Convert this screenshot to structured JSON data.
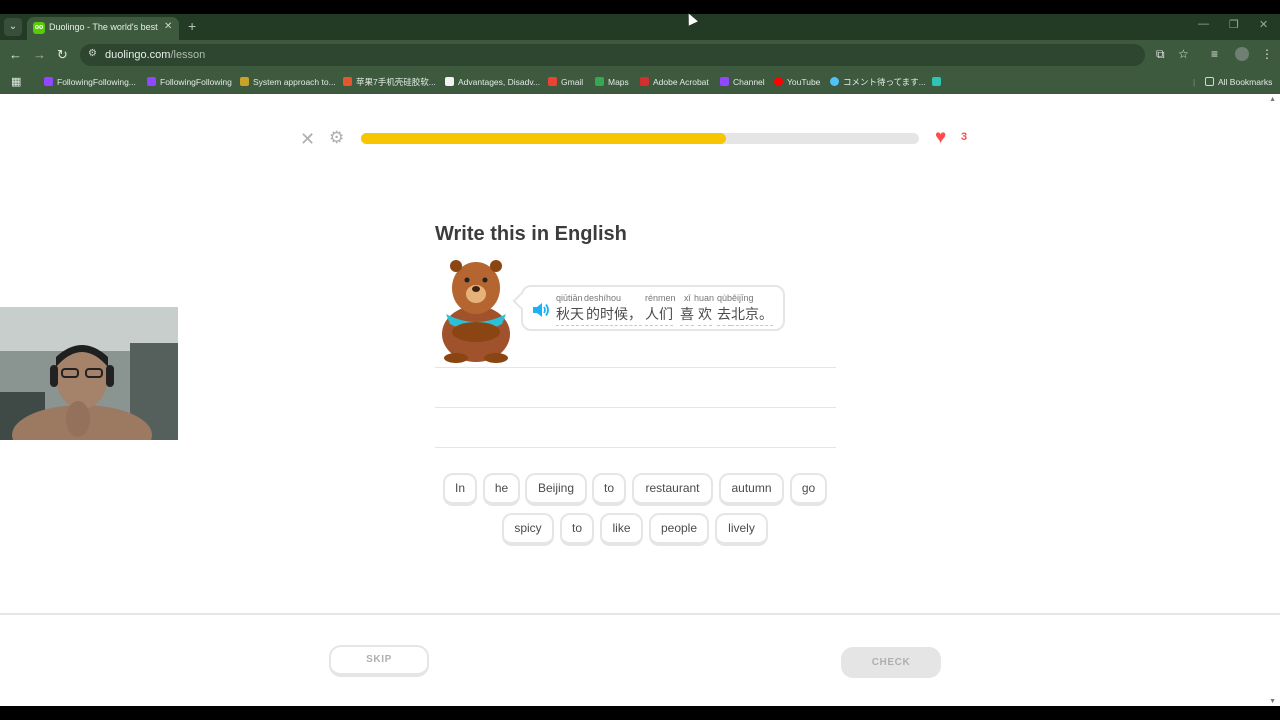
{
  "browser": {
    "tab_title": "Duolingo - The world's best way to learn",
    "new_tab": "+",
    "url_domain": "duolingo.com",
    "url_path": "/lesson",
    "bookmarks": [
      "FollowingFollowing...",
      "FollowingFollowing",
      "System approach to...",
      "苹果7手机壳硅胶软...",
      "Advantages, Disadv...",
      "Gmail",
      "Maps",
      "Adobe Acrobat",
      "Channel",
      "YouTube",
      "コメント待ってます..."
    ],
    "all_bookmarks": "All Bookmarks"
  },
  "lesson": {
    "progress_fraction": 0.655,
    "hearts": "3",
    "prompt": "Write this in English",
    "pinyin": [
      "qiūtiān",
      "deshíhou",
      "rénmen",
      "xǐ",
      "huan",
      "qù",
      "běijīng"
    ],
    "hanzi": [
      "秋天",
      "的时候，",
      "人们",
      "喜",
      "欢",
      "去",
      "北京。"
    ],
    "word_bank_row1": [
      "In",
      "he",
      "Beijing",
      "to",
      "restaurant",
      "autumn",
      "go"
    ],
    "word_bank_row2": [
      "spicy",
      "to",
      "like",
      "people",
      "lively"
    ],
    "skip_label": "SKIP",
    "check_label": "CHECK"
  },
  "colors": {
    "progress": "#f7c600",
    "heart": "#ff4b4b",
    "chrome_green": "#3d5a3f"
  }
}
